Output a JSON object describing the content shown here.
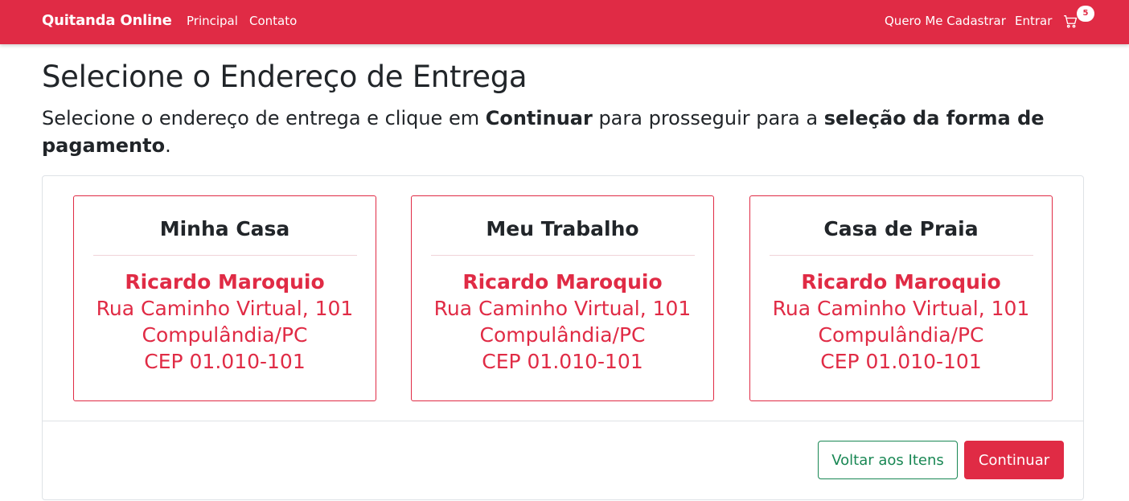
{
  "nav": {
    "brand": "Quitanda Online",
    "links": [
      "Principal",
      "Contato"
    ],
    "right_links": [
      "Quero Me Cadastrar",
      "Entrar"
    ],
    "cart_count": "5"
  },
  "page": {
    "title": "Selecione o Endereço de Entrega",
    "subtitle_parts": {
      "p1": "Selecione o endereço de entrega e clique em ",
      "b1": "Continuar",
      "p2": " para prosseguir para a ",
      "b2": "seleção da forma de pagamento",
      "p3": "."
    }
  },
  "addresses": [
    {
      "label": "Minha Casa",
      "name": "Ricardo Maroquio",
      "street": "Rua Caminho Virtual, 101",
      "city": "Compulândia/PC",
      "cep": "CEP 01.010-101"
    },
    {
      "label": "Meu Trabalho",
      "name": "Ricardo Maroquio",
      "street": "Rua Caminho Virtual, 101",
      "city": "Compulândia/PC",
      "cep": "CEP 01.010-101"
    },
    {
      "label": "Casa de Praia",
      "name": "Ricardo Maroquio",
      "street": "Rua Caminho Virtual, 101",
      "city": "Compulândia/PC",
      "cep": "CEP 01.010-101"
    }
  ],
  "buttons": {
    "back": "Voltar aos Itens",
    "continue": "Continuar"
  },
  "colors": {
    "primary": "#e02b45",
    "success": "#198754"
  },
  "icons": {
    "cart": "cart-icon"
  }
}
